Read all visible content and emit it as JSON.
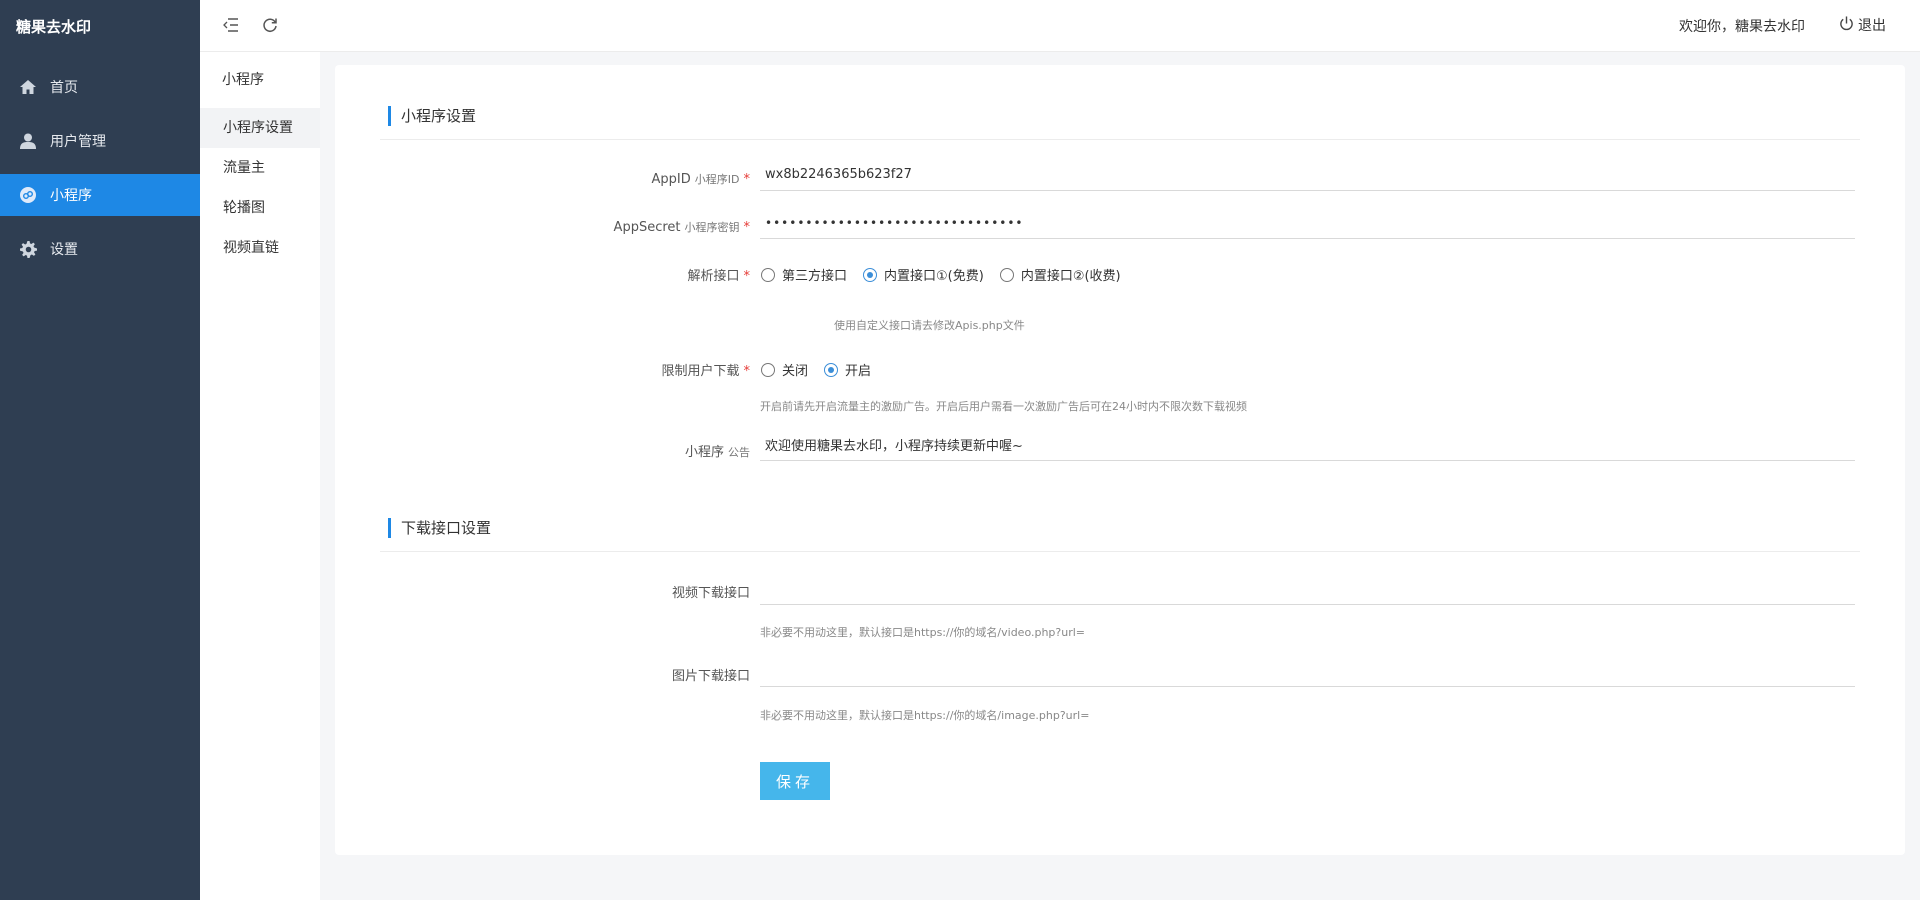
{
  "app": {
    "brand": "糖果去水印"
  },
  "sidebar": {
    "items": [
      {
        "label": "首页",
        "icon": "home-icon"
      },
      {
        "label": "用户管理",
        "icon": "user-icon"
      },
      {
        "label": "小程序",
        "icon": "miniprogram-icon",
        "active": true
      },
      {
        "label": "设置",
        "icon": "gear-icon"
      }
    ]
  },
  "header": {
    "welcome": "欢迎你，糖果去水印",
    "logout": "退出"
  },
  "submenu": {
    "title": "小程序",
    "items": [
      {
        "label": "小程序设置",
        "active": true
      },
      {
        "label": "流量主"
      },
      {
        "label": "轮播图"
      },
      {
        "label": "视频直链"
      }
    ]
  },
  "form": {
    "section1_title": "小程序设置",
    "appid": {
      "label": "AppID",
      "sub": "小程序ID",
      "value": "wx8b2246365b623f27"
    },
    "appsecret": {
      "label": "AppSecret",
      "sub": "小程序密钥",
      "value": "••••••••••••••••••••••••••••••••"
    },
    "api": {
      "label": "解析接口",
      "options": [
        "第三方接口",
        "内置接口①(免费)",
        "内置接口②(收费)"
      ],
      "selected": 1,
      "hint": "使用自定义接口请去修改Apis.php文件"
    },
    "limit": {
      "label": "限制用户下载",
      "options": [
        "关闭",
        "开启"
      ],
      "selected": 1,
      "hint": "开启前请先开启流量主的激励广告。开启后用户需看一次激励广告后可在24小时内不限次数下载视频"
    },
    "notice": {
      "label": "小程序",
      "sub": "公告",
      "value": "欢迎使用糖果去水印，小程序持续更新中喔~"
    },
    "section2_title": "下载接口设置",
    "video_api": {
      "label": "视频下载接口",
      "value": "",
      "hint": "非必要不用动这里，默认接口是https://你的域名/video.php?url="
    },
    "image_api": {
      "label": "图片下载接口",
      "value": "",
      "hint": "非必要不用动这里，默认接口是https://你的域名/image.php?url="
    },
    "required_mark": "*",
    "save_label": "保存"
  },
  "colors": {
    "sidebar_bg": "#2f3e52",
    "accent": "#1e88e5",
    "button": "#45b6eb"
  }
}
